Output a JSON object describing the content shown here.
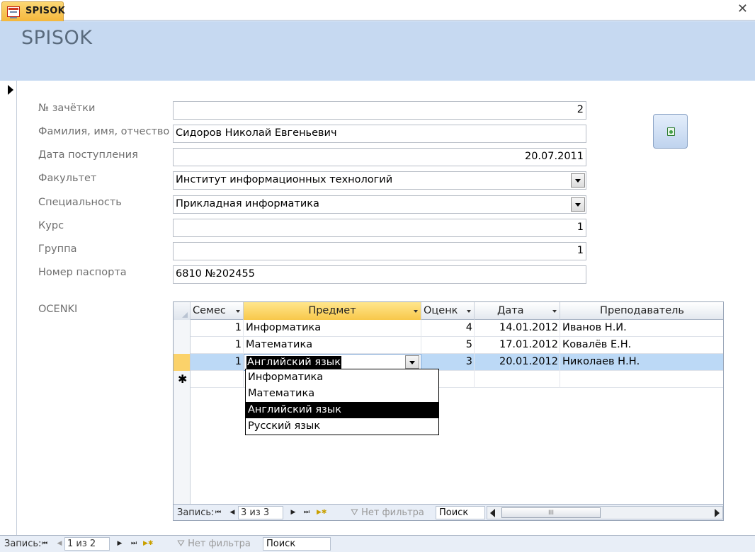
{
  "tab": {
    "label": "SPISOK",
    "close_icon": "close-icon"
  },
  "form": {
    "title": "SPISOK"
  },
  "fields": {
    "zachetka": {
      "label": "№ зачётки",
      "value": "2"
    },
    "fio": {
      "label": "Фамилия, имя, отчество",
      "value": "Сидоров Николай Евгеньевич"
    },
    "date": {
      "label": "Дата поступления",
      "value": "20.07.2011"
    },
    "faculty": {
      "label": "Факультет",
      "value": "Институт информационных технологий"
    },
    "specialty": {
      "label": "Специальность",
      "value": "Прикладная информатика"
    },
    "course": {
      "label": "Курс",
      "value": "1"
    },
    "group": {
      "label": "Группа",
      "value": "1"
    },
    "passport": {
      "label": "Номер паспорта",
      "value": "6810 №202455"
    }
  },
  "subform": {
    "label": "OCENKI",
    "columns": [
      "Семес",
      "Предмет",
      "Оценк",
      "Дата",
      "Преподаватель"
    ],
    "rows": [
      {
        "sem": "1",
        "subject": "Информатика",
        "grade": "4",
        "date": "14.01.2012",
        "teacher": "Иванов Н.И."
      },
      {
        "sem": "1",
        "subject": "Математика",
        "grade": "5",
        "date": "17.01.2012",
        "teacher": "Ковалёв Е.Н."
      },
      {
        "sem": "1",
        "subject": "Английский язык",
        "grade": "3",
        "date": "20.01.2012",
        "teacher": "Николаев Н.Н."
      }
    ],
    "new_row_marker": "✱",
    "dropdown": [
      "Информатика",
      "Математика",
      "Английский язык",
      "Русский язык"
    ],
    "selected_option": "Английский язык",
    "nav": {
      "record_label": "Запись:",
      "record_value": "3 из 3",
      "filter": "Нет фильтра",
      "search": "Поиск",
      "scroll_glyph": "III"
    }
  },
  "main_nav": {
    "record_label": "Запись:",
    "record_value": "1 из 2",
    "filter": "Нет фильтра",
    "search": "Поиск"
  },
  "colors": {
    "header_band": "#c6d9f1",
    "active_tab": "#f4b73c",
    "current_row": "#bcd9f6",
    "selector_active": "#fbd26a"
  }
}
